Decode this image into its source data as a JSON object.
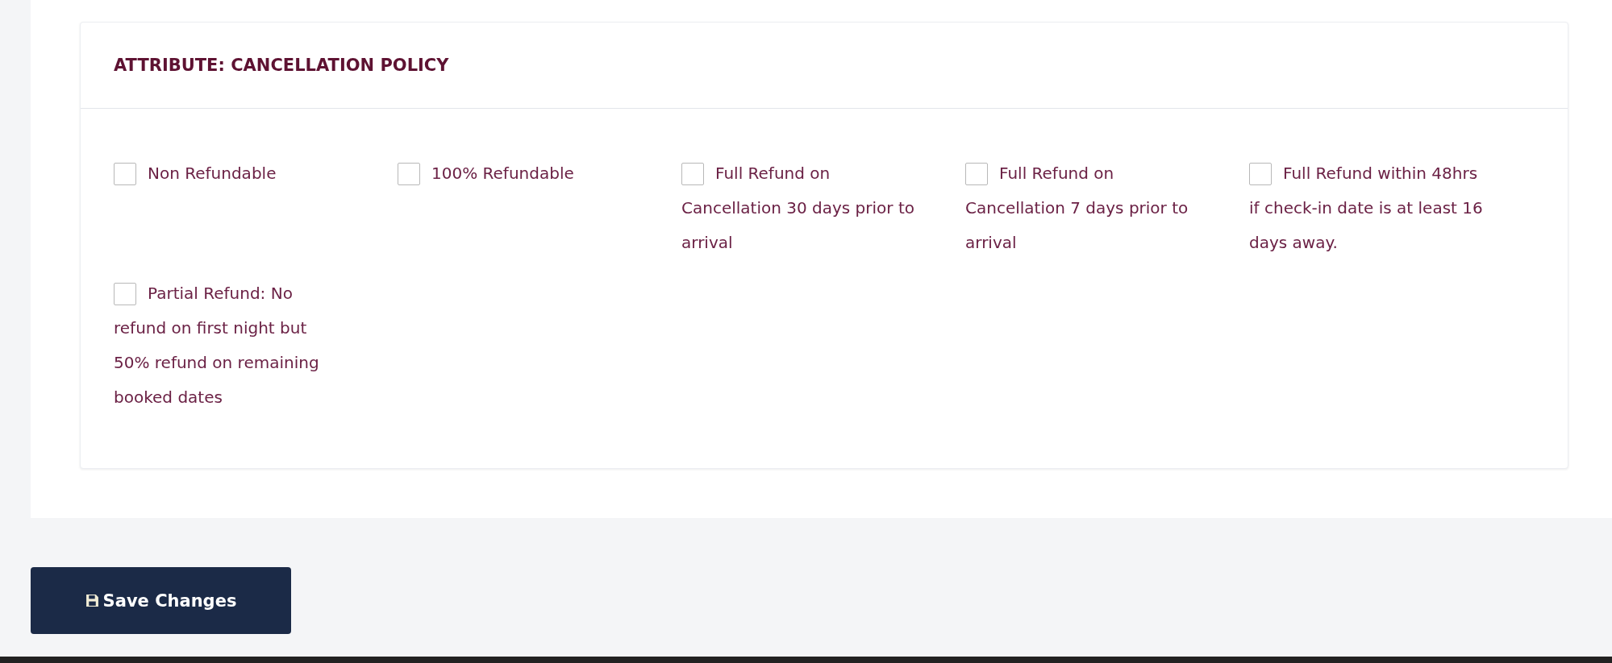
{
  "card": {
    "title": "ATTRIBUTE: CANCELLATION POLICY",
    "options": [
      {
        "label": "Non Refundable",
        "checked": false
      },
      {
        "label": "100% Refundable",
        "checked": false
      },
      {
        "label": "Full Refund on Cancellation 30 days prior to arrival",
        "checked": false
      },
      {
        "label": "Full Refund on Cancellation 7 days prior to arrival",
        "checked": false
      },
      {
        "label": "Full Refund within 48hrs if check-in date is at least 16 days away.",
        "checked": false
      },
      {
        "label": "Partial Refund: No refund on first night but 50% refund on remaining booked dates",
        "checked": false
      }
    ]
  },
  "save_button": {
    "label": "Save Changes"
  }
}
